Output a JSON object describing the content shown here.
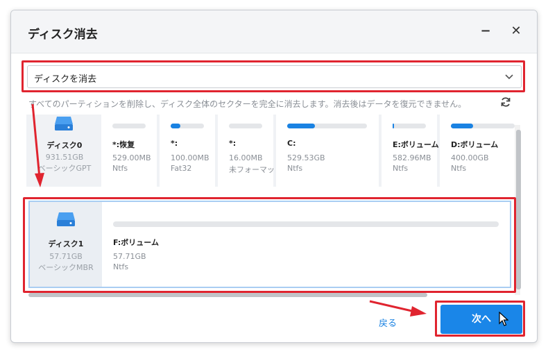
{
  "dialog": {
    "title": "ディスク消去",
    "minimize": "−",
    "close": "✕"
  },
  "mode_select": {
    "selected": "ディスクを消去",
    "chevron": "chevron-down-icon"
  },
  "description": "すべてのパーティションを削除し、ディスク全体のセクターを完全に消去します。消去後はデータを復元できません。",
  "refresh_icon": "refresh-icon",
  "disks": [
    {
      "name": "ディスク0",
      "size": "931.51GB",
      "type": "ベーシックGPT",
      "partitions": [
        {
          "name": "*:恢复",
          "size": "529.00MB",
          "fs": "Ntfs",
          "used": 0
        },
        {
          "name": "*:",
          "size": "100.00MB",
          "fs": "Fat32",
          "used": 0.3
        },
        {
          "name": "*:",
          "size": "16.00MB",
          "fs": "未フォーマット",
          "used": 0
        },
        {
          "name": "C:",
          "size": "529.53GB",
          "fs": "Ntfs",
          "used": 0.35
        },
        {
          "name": "E:ボリューム",
          "size": "582.96MB",
          "fs": "Ntfs",
          "used": 0.05
        },
        {
          "name": "D:ボリューム",
          "size": "400.00GB",
          "fs": "Ntfs",
          "used": 0.35
        }
      ]
    },
    {
      "name": "ディスク1",
      "size": "57.71GB",
      "type": "ベーシックMBR",
      "partitions": [
        {
          "name": "F:ボリューム",
          "size": "57.71GB",
          "fs": "Ntfs",
          "used": 0
        }
      ]
    }
  ],
  "buttons": {
    "back": "戻る",
    "next": "次へ"
  },
  "colors": {
    "accent": "#1a86e8",
    "highlight": "#e0242f",
    "usage_bar": "#1a82e2"
  }
}
